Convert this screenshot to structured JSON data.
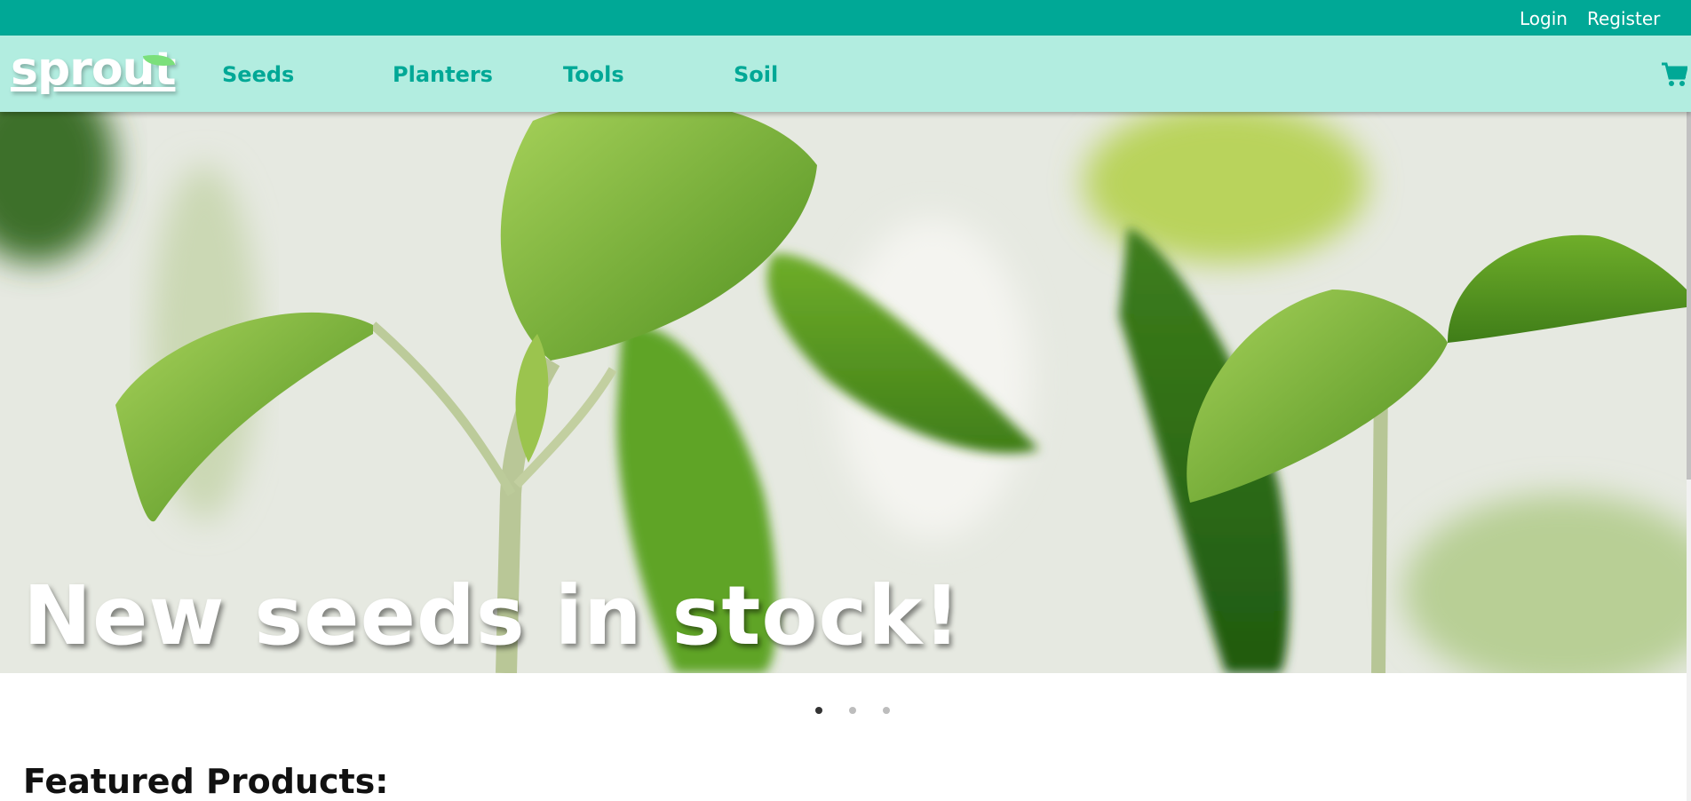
{
  "topbar": {
    "login_label": "Login",
    "register_label": "Register",
    "background_color": "#00a896"
  },
  "navbar": {
    "logo_text": "sprout",
    "background_color": "#b2ede0",
    "link_color": "#00a896",
    "items": [
      {
        "label": "Seeds"
      },
      {
        "label": "Planters"
      },
      {
        "label": "Tools"
      },
      {
        "label": "Soil"
      }
    ],
    "cart_icon": "shopping-cart-icon"
  },
  "hero": {
    "caption": "New seeds in stock!",
    "image": "seedling-sprouts-photo",
    "slide_count": 3,
    "active_slide": 1
  },
  "featured": {
    "title": "Featured Products:"
  }
}
